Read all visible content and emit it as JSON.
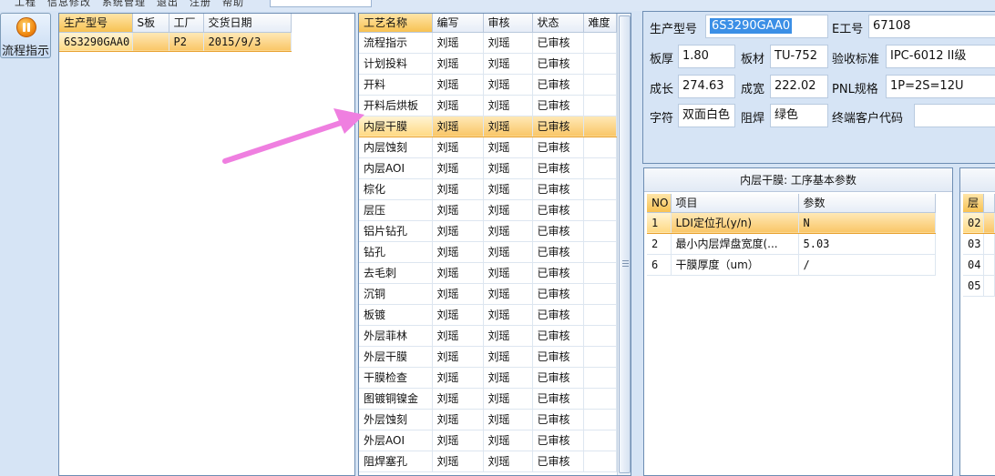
{
  "topbar": {
    "menu": "工程　信息修改　系统管理　退出　注册　帮助"
  },
  "toolbar": {
    "flow_btn": "流程指示"
  },
  "products": {
    "columns": [
      "生产型号",
      "S板",
      "工厂",
      "交货日期"
    ],
    "rows": [
      {
        "model": "6S3290GAA0",
        "s": "",
        "factory": "P2",
        "date": "2015/9/3"
      }
    ]
  },
  "processes": {
    "columns": [
      "工艺名称",
      "编写",
      "审核",
      "状态",
      "难度"
    ],
    "rows": [
      {
        "name": "流程指示",
        "writer": "刘瑶",
        "reviewer": "刘瑶",
        "status": "已审核",
        "difficulty": ""
      },
      {
        "name": "计划投料",
        "writer": "刘瑶",
        "reviewer": "刘瑶",
        "status": "已审核",
        "difficulty": ""
      },
      {
        "name": "开料",
        "writer": "刘瑶",
        "reviewer": "刘瑶",
        "status": "已审核",
        "difficulty": ""
      },
      {
        "name": "开料后烘板",
        "writer": "刘瑶",
        "reviewer": "刘瑶",
        "status": "已审核",
        "difficulty": ""
      },
      {
        "name": "内层干膜",
        "writer": "刘瑶",
        "reviewer": "刘瑶",
        "status": "已审核",
        "difficulty": ""
      },
      {
        "name": "内层蚀刻",
        "writer": "刘瑶",
        "reviewer": "刘瑶",
        "status": "已审核",
        "difficulty": ""
      },
      {
        "name": "内层AOI",
        "writer": "刘瑶",
        "reviewer": "刘瑶",
        "status": "已审核",
        "difficulty": ""
      },
      {
        "name": "棕化",
        "writer": "刘瑶",
        "reviewer": "刘瑶",
        "status": "已审核",
        "difficulty": ""
      },
      {
        "name": "层压",
        "writer": "刘瑶",
        "reviewer": "刘瑶",
        "status": "已审核",
        "difficulty": ""
      },
      {
        "name": "铝片钻孔",
        "writer": "刘瑶",
        "reviewer": "刘瑶",
        "status": "已审核",
        "difficulty": ""
      },
      {
        "name": "钻孔",
        "writer": "刘瑶",
        "reviewer": "刘瑶",
        "status": "已审核",
        "difficulty": ""
      },
      {
        "name": "去毛刺",
        "writer": "刘瑶",
        "reviewer": "刘瑶",
        "status": "已审核",
        "difficulty": ""
      },
      {
        "name": "沉铜",
        "writer": "刘瑶",
        "reviewer": "刘瑶",
        "status": "已审核",
        "difficulty": ""
      },
      {
        "name": "板镀",
        "writer": "刘瑶",
        "reviewer": "刘瑶",
        "status": "已审核",
        "difficulty": ""
      },
      {
        "name": "外层菲林",
        "writer": "刘瑶",
        "reviewer": "刘瑶",
        "status": "已审核",
        "difficulty": ""
      },
      {
        "name": "外层干膜",
        "writer": "刘瑶",
        "reviewer": "刘瑶",
        "status": "已审核",
        "difficulty": ""
      },
      {
        "name": "干膜检查",
        "writer": "刘瑶",
        "reviewer": "刘瑶",
        "status": "已审核",
        "difficulty": ""
      },
      {
        "name": "图镀铜镍金",
        "writer": "刘瑶",
        "reviewer": "刘瑶",
        "status": "已审核",
        "difficulty": ""
      },
      {
        "name": "外层蚀刻",
        "writer": "刘瑶",
        "reviewer": "刘瑶",
        "status": "已审核",
        "difficulty": ""
      },
      {
        "name": "外层AOI",
        "writer": "刘瑶",
        "reviewer": "刘瑶",
        "status": "已审核",
        "difficulty": ""
      },
      {
        "name": "阻焊塞孔",
        "writer": "刘瑶",
        "reviewer": "刘瑶",
        "status": "已审核",
        "difficulty": ""
      }
    ]
  },
  "info": {
    "model_label": "生产型号",
    "model_value": "6S3290GAA0",
    "eng_label": "E工号",
    "eng_value": "67108",
    "thickness_label": "板厚",
    "thickness_value": "1.80",
    "material_label": "板材",
    "material_value": "TU-752",
    "standard_label": "验收标准",
    "standard_value": "IPC-6012 II级",
    "length_label": "成长",
    "length_value": "274.63",
    "width_label": "成宽",
    "width_value": "222.02",
    "pnl_label": "PNL规格",
    "pnl_value": "1P=2S=12U",
    "char_label": "字符",
    "char_value": "双面白色",
    "mask_label": "阻焊",
    "mask_value": "绿色",
    "customer_label": "终端客户代码",
    "customer_value": ""
  },
  "params": {
    "title": "内层干膜: 工序基本参数",
    "columns": [
      "NO",
      "项目",
      "参数"
    ],
    "rows": [
      {
        "no": "1",
        "item": "LDI定位孔(y/n)",
        "value": "N"
      },
      {
        "no": "2",
        "item": "最小内层焊盘宽度(...",
        "value": "5.03"
      },
      {
        "no": "6",
        "item": "干膜厚度（um）",
        "value": "/"
      }
    ]
  },
  "layers": {
    "columns": [
      "层"
    ],
    "rows": [
      "02",
      "03",
      "04",
      "05"
    ]
  },
  "colors": {
    "selection": "#f9c667",
    "annotation_arrow": "#ef7fe0",
    "text_highlight": "#3b8fe6"
  }
}
